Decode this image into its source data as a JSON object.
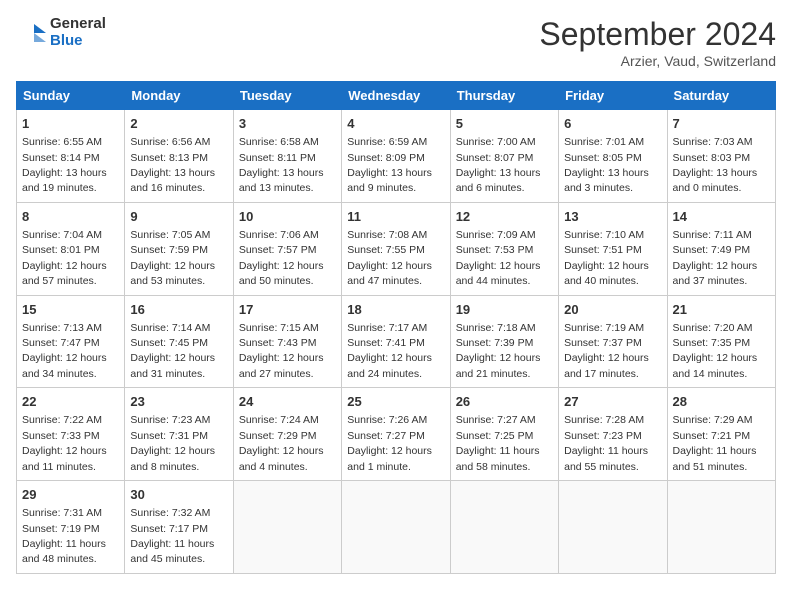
{
  "logo": {
    "line1": "General",
    "line2": "Blue"
  },
  "title": "September 2024",
  "subtitle": "Arzier, Vaud, Switzerland",
  "headers": [
    "Sunday",
    "Monday",
    "Tuesday",
    "Wednesday",
    "Thursday",
    "Friday",
    "Saturday"
  ],
  "weeks": [
    [
      {
        "day": "1",
        "sunrise": "6:55 AM",
        "sunset": "8:14 PM",
        "daylight": "13 hours and 19 minutes."
      },
      {
        "day": "2",
        "sunrise": "6:56 AM",
        "sunset": "8:13 PM",
        "daylight": "13 hours and 16 minutes."
      },
      {
        "day": "3",
        "sunrise": "6:58 AM",
        "sunset": "8:11 PM",
        "daylight": "13 hours and 13 minutes."
      },
      {
        "day": "4",
        "sunrise": "6:59 AM",
        "sunset": "8:09 PM",
        "daylight": "13 hours and 9 minutes."
      },
      {
        "day": "5",
        "sunrise": "7:00 AM",
        "sunset": "8:07 PM",
        "daylight": "13 hours and 6 minutes."
      },
      {
        "day": "6",
        "sunrise": "7:01 AM",
        "sunset": "8:05 PM",
        "daylight": "13 hours and 3 minutes."
      },
      {
        "day": "7",
        "sunrise": "7:03 AM",
        "sunset": "8:03 PM",
        "daylight": "13 hours and 0 minutes."
      }
    ],
    [
      {
        "day": "8",
        "sunrise": "7:04 AM",
        "sunset": "8:01 PM",
        "daylight": "12 hours and 57 minutes."
      },
      {
        "day": "9",
        "sunrise": "7:05 AM",
        "sunset": "7:59 PM",
        "daylight": "12 hours and 53 minutes."
      },
      {
        "day": "10",
        "sunrise": "7:06 AM",
        "sunset": "7:57 PM",
        "daylight": "12 hours and 50 minutes."
      },
      {
        "day": "11",
        "sunrise": "7:08 AM",
        "sunset": "7:55 PM",
        "daylight": "12 hours and 47 minutes."
      },
      {
        "day": "12",
        "sunrise": "7:09 AM",
        "sunset": "7:53 PM",
        "daylight": "12 hours and 44 minutes."
      },
      {
        "day": "13",
        "sunrise": "7:10 AM",
        "sunset": "7:51 PM",
        "daylight": "12 hours and 40 minutes."
      },
      {
        "day": "14",
        "sunrise": "7:11 AM",
        "sunset": "7:49 PM",
        "daylight": "12 hours and 37 minutes."
      }
    ],
    [
      {
        "day": "15",
        "sunrise": "7:13 AM",
        "sunset": "7:47 PM",
        "daylight": "12 hours and 34 minutes."
      },
      {
        "day": "16",
        "sunrise": "7:14 AM",
        "sunset": "7:45 PM",
        "daylight": "12 hours and 31 minutes."
      },
      {
        "day": "17",
        "sunrise": "7:15 AM",
        "sunset": "7:43 PM",
        "daylight": "12 hours and 27 minutes."
      },
      {
        "day": "18",
        "sunrise": "7:17 AM",
        "sunset": "7:41 PM",
        "daylight": "12 hours and 24 minutes."
      },
      {
        "day": "19",
        "sunrise": "7:18 AM",
        "sunset": "7:39 PM",
        "daylight": "12 hours and 21 minutes."
      },
      {
        "day": "20",
        "sunrise": "7:19 AM",
        "sunset": "7:37 PM",
        "daylight": "12 hours and 17 minutes."
      },
      {
        "day": "21",
        "sunrise": "7:20 AM",
        "sunset": "7:35 PM",
        "daylight": "12 hours and 14 minutes."
      }
    ],
    [
      {
        "day": "22",
        "sunrise": "7:22 AM",
        "sunset": "7:33 PM",
        "daylight": "12 hours and 11 minutes."
      },
      {
        "day": "23",
        "sunrise": "7:23 AM",
        "sunset": "7:31 PM",
        "daylight": "12 hours and 8 minutes."
      },
      {
        "day": "24",
        "sunrise": "7:24 AM",
        "sunset": "7:29 PM",
        "daylight": "12 hours and 4 minutes."
      },
      {
        "day": "25",
        "sunrise": "7:26 AM",
        "sunset": "7:27 PM",
        "daylight": "12 hours and 1 minute."
      },
      {
        "day": "26",
        "sunrise": "7:27 AM",
        "sunset": "7:25 PM",
        "daylight": "11 hours and 58 minutes."
      },
      {
        "day": "27",
        "sunrise": "7:28 AM",
        "sunset": "7:23 PM",
        "daylight": "11 hours and 55 minutes."
      },
      {
        "day": "28",
        "sunrise": "7:29 AM",
        "sunset": "7:21 PM",
        "daylight": "11 hours and 51 minutes."
      }
    ],
    [
      {
        "day": "29",
        "sunrise": "7:31 AM",
        "sunset": "7:19 PM",
        "daylight": "11 hours and 48 minutes."
      },
      {
        "day": "30",
        "sunrise": "7:32 AM",
        "sunset": "7:17 PM",
        "daylight": "11 hours and 45 minutes."
      },
      null,
      null,
      null,
      null,
      null
    ]
  ],
  "labels": {
    "sunrise": "Sunrise:",
    "sunset": "Sunset:",
    "daylight": "Daylight:"
  }
}
